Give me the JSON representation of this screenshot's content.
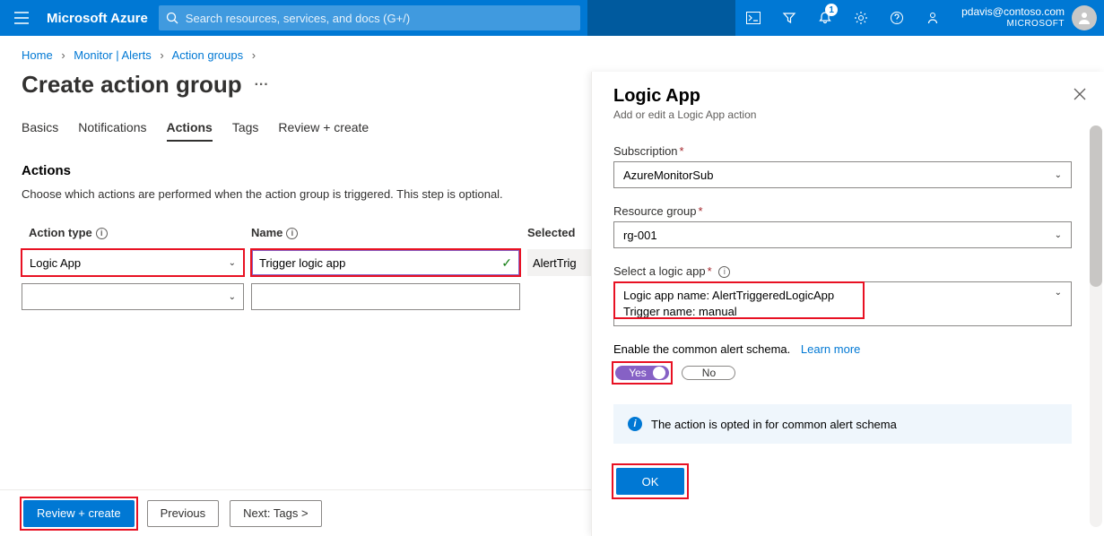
{
  "header": {
    "brand": "Microsoft Azure",
    "search_placeholder": "Search resources, services, and docs (G+/)",
    "notification_count": "1",
    "account_email": "pdavis@contoso.com",
    "account_tenant": "MICROSOFT"
  },
  "breadcrumb": {
    "home": "Home",
    "monitor": "Monitor | Alerts",
    "action_groups": "Action groups"
  },
  "page": {
    "title": "Create action group",
    "tabs": {
      "basics": "Basics",
      "notifications": "Notifications",
      "actions": "Actions",
      "tags": "Tags",
      "review": "Review + create"
    },
    "section_title": "Actions",
    "section_desc": "Choose which actions are performed when the action group is triggered. This step is optional.",
    "col_action_type": "Action type",
    "col_name": "Name",
    "col_selected": "Selected",
    "row1_type": "Logic App",
    "row1_name": "Trigger logic app",
    "row1_selected": "AlertTrig",
    "footer": {
      "review": "Review + create",
      "previous": "Previous",
      "next": "Next: Tags >"
    }
  },
  "panel": {
    "title": "Logic App",
    "subtitle": "Add or edit a Logic App action",
    "subscription_label": "Subscription",
    "subscription_value": "AzureMonitorSub",
    "rg_label": "Resource group",
    "rg_value": "rg-001",
    "logicapp_label": "Select a logic app",
    "logicapp_line1": "Logic app name: AlertTriggeredLogicApp",
    "logicapp_line2": "Trigger name: manual",
    "schema_text": "Enable the common alert schema.",
    "learn_more": "Learn more",
    "toggle_yes": "Yes",
    "toggle_no": "No",
    "banner": "The action is opted in for common alert schema",
    "ok": "OK"
  }
}
